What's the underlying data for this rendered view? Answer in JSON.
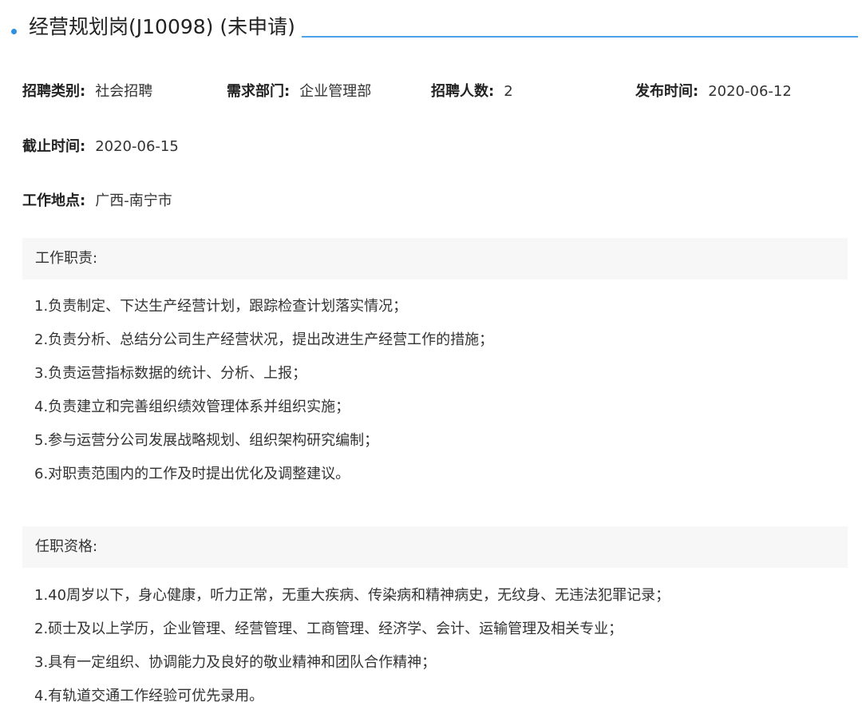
{
  "job": {
    "title": "经营规划岗(J10098) (未申请)"
  },
  "meta": {
    "category_label": "招聘类别:",
    "category_value": "社会招聘",
    "dept_label": "需求部门:",
    "dept_value": "企业管理部",
    "count_label": "招聘人数:",
    "count_value": "2",
    "publish_label": "发布时间:",
    "publish_value": "2020-06-12",
    "deadline_label": "截止时间:",
    "deadline_value": "2020-06-15",
    "location_label": "工作地点:",
    "location_value": "广西-南宁市"
  },
  "duties": {
    "heading": "工作职责:",
    "items": [
      "1.负责制定、下达生产经营计划，跟踪检查计划落实情况；",
      "2.负责分析、总结分公司生产经营状况，提出改进生产经营工作的措施；",
      "3.负责运营指标数据的统计、分析、上报；",
      "4.负责建立和完善组织绩效管理体系并组织实施；",
      "5.参与运营分公司发展战略规划、组织架构研究编制；",
      "6.对职责范围内的工作及时提出优化及调整建议。"
    ]
  },
  "requirements": {
    "heading": "任职资格:",
    "items": [
      "1.40周岁以下，身心健康，听力正常，无重大疾病、传染病和精神病史，无纹身、无违法犯罪记录；",
      "2.硕士及以上学历，企业管理、经营管理、工商管理、经济学、会计、运输管理及相关专业；",
      "3.具有一定组织、协调能力及良好的敬业精神和团队合作精神；",
      "4.有轨道交通工作经验可优先录用。"
    ]
  },
  "colors": {
    "accent": "#2f8fe0",
    "section_bg": "#f7f7f7"
  }
}
